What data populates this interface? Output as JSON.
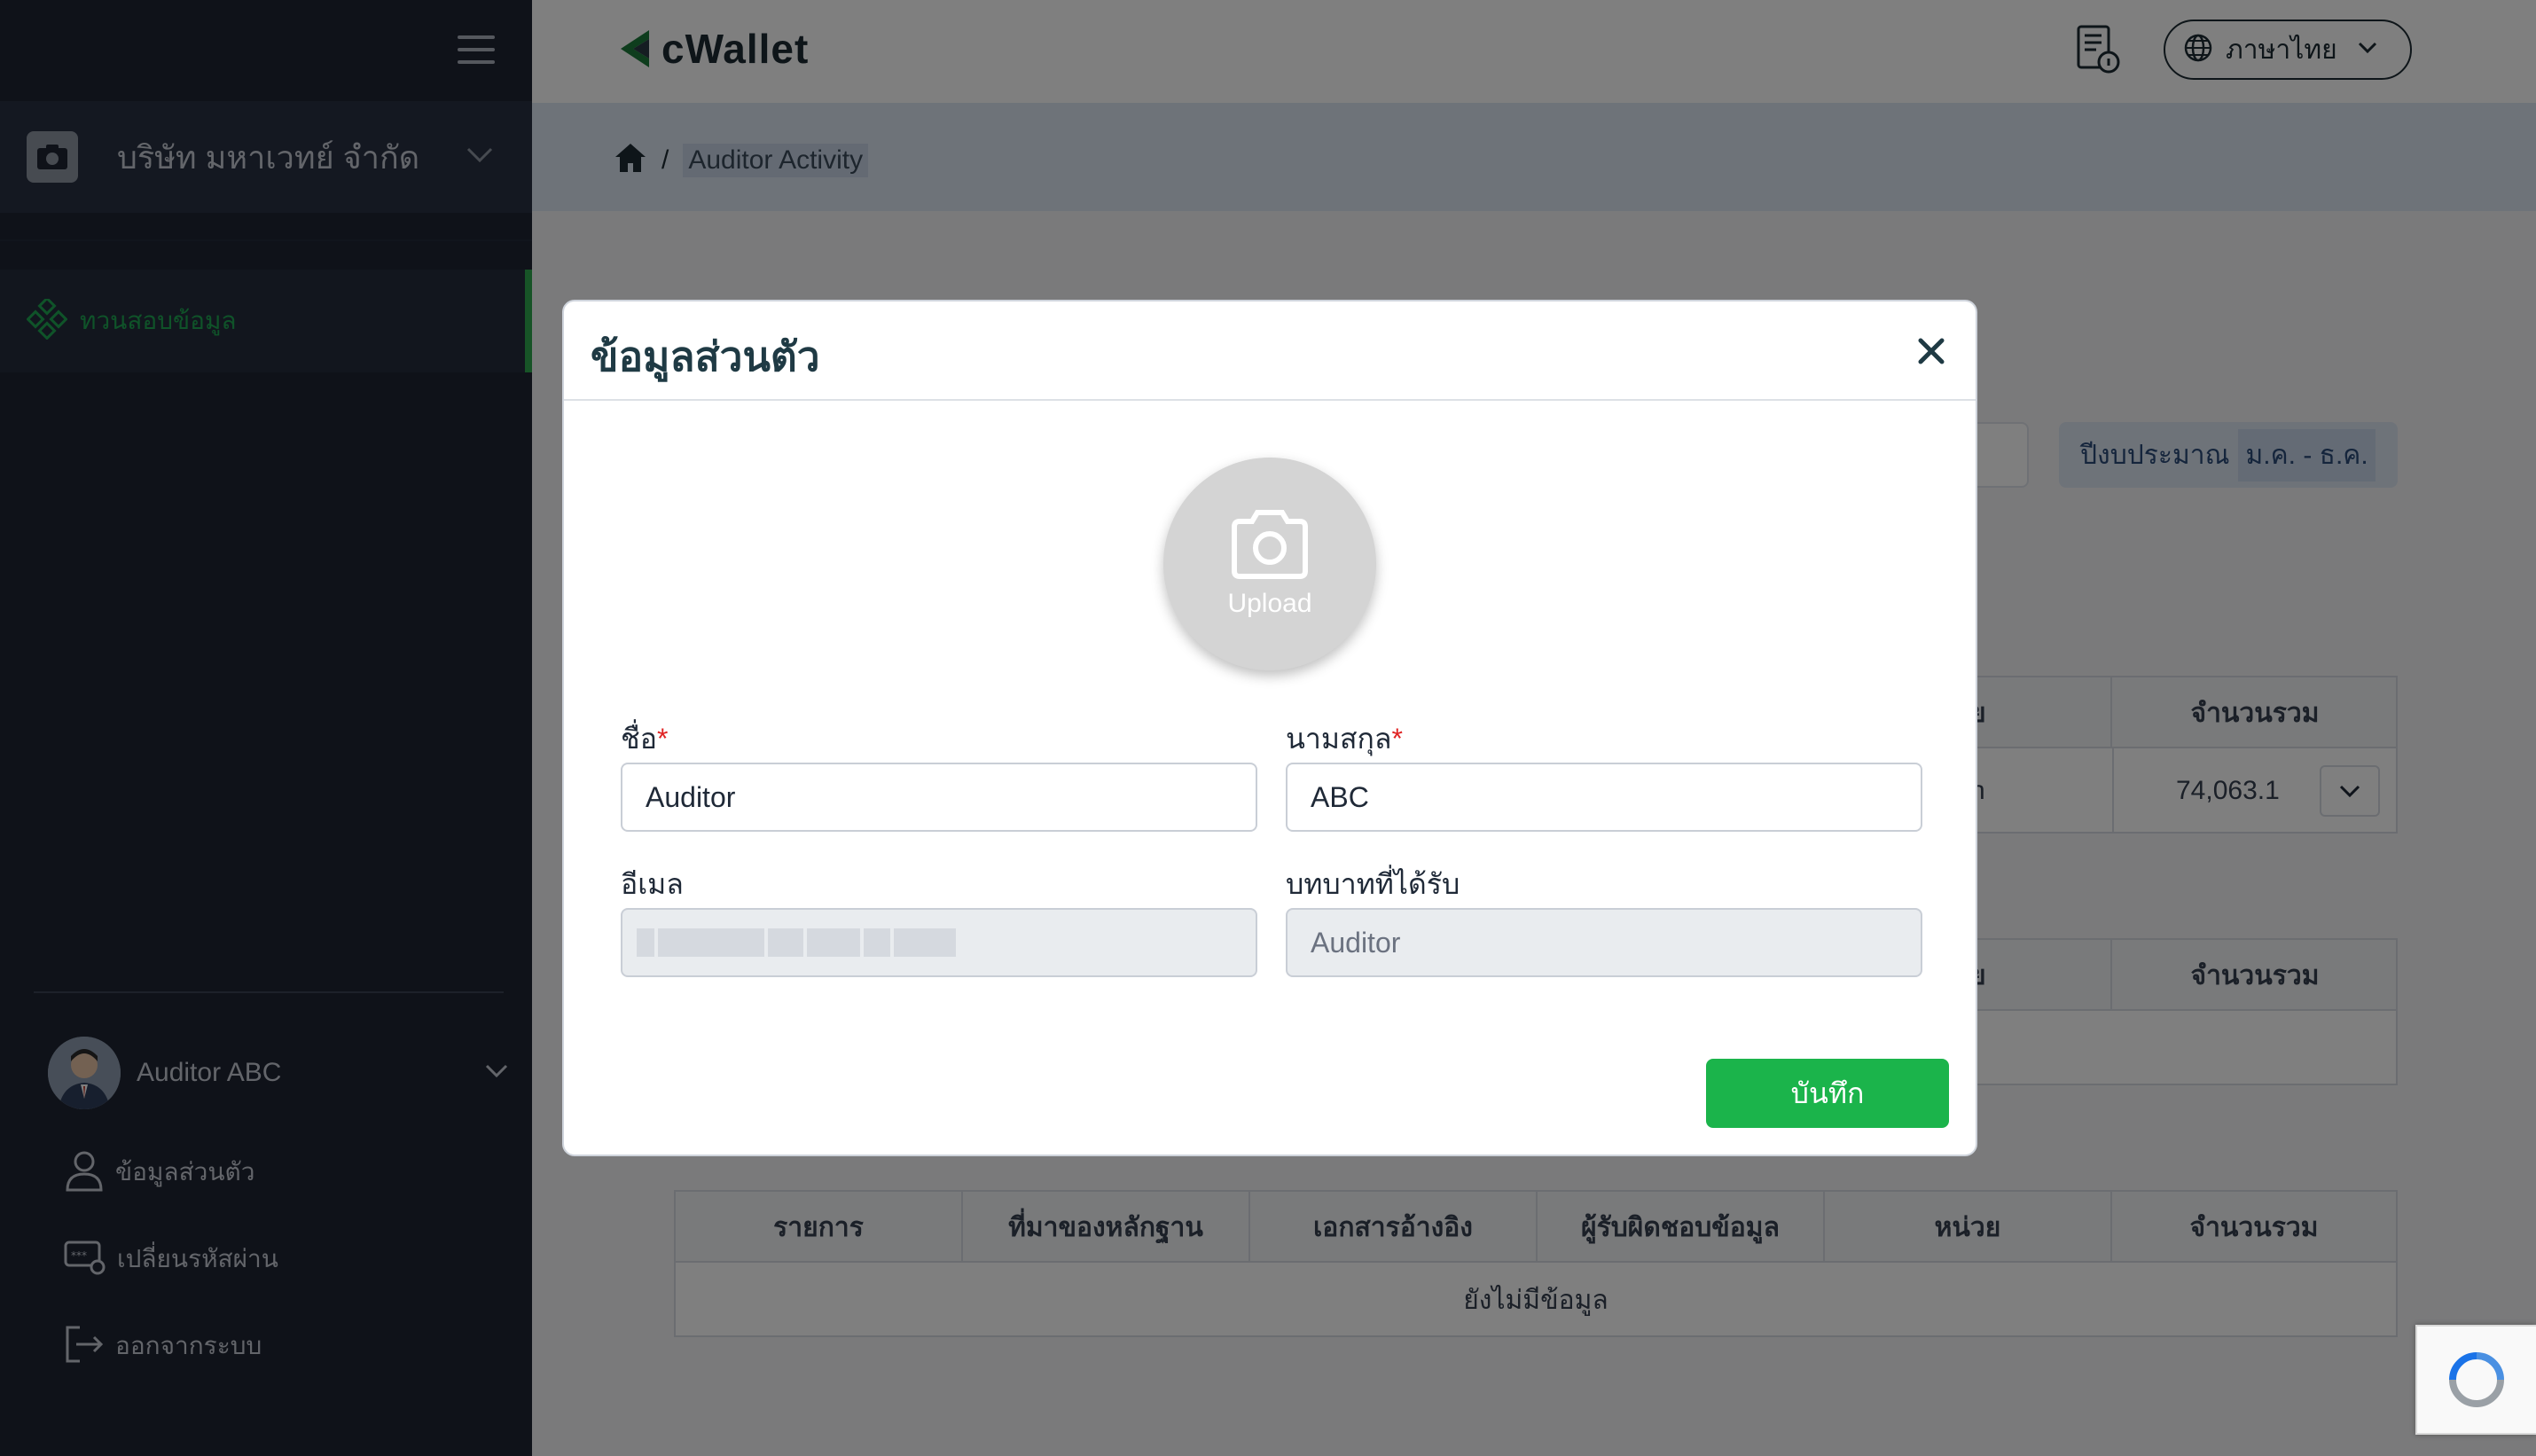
{
  "sidebar": {
    "company_name": "บริษัท มหาเวทย์ จำกัด",
    "menu_active": "ทวนสอบข้อมูล",
    "user_name": "Auditor ABC",
    "sub_items": [
      "ข้อมูลส่วนตัว",
      "เปลี่ยนรหัสผ่าน",
      "ออกจากระบบ"
    ]
  },
  "topbar": {
    "logo_text": "cWallet",
    "language": "ภาษาไทย"
  },
  "breadcrumb": {
    "separator": "/",
    "current": "Auditor Activity"
  },
  "filter": {
    "fiscal_label": "ปีงบประมาณ",
    "fiscal_value": "ม.ค. - ธ.ค."
  },
  "table1": {
    "headers": [
      "ย",
      "จำนวนรวม"
    ],
    "row": [
      "h",
      "74,063.1"
    ]
  },
  "table2": {
    "headers": [
      "ย",
      "จำนวนรวม"
    ]
  },
  "table3": {
    "headers": [
      "รายการ",
      "ที่มาของหลักฐาน",
      "เอกสารอ้างอิง",
      "ผู้รับผิดชอบข้อมูล",
      "หน่วย",
      "จำนวนรวม"
    ],
    "empty_text": "ยังไม่มีข้อมูล"
  },
  "modal": {
    "title": "ข้อมูลส่วนตัว",
    "upload_label": "Upload",
    "first_name_label": "ชื่อ",
    "first_name_value": "Auditor",
    "last_name_label": "นามสกุล",
    "last_name_value": "ABC",
    "email_label": "อีเมล",
    "role_label": "บทบาทที่ได้รับ",
    "role_value": "Auditor",
    "required_mark": "*",
    "save_label": "บันทึก"
  },
  "colors": {
    "sidebar_bg": "#1e2433",
    "accent_green": "#1bb44b",
    "brand_dark": "#1c2a33"
  }
}
